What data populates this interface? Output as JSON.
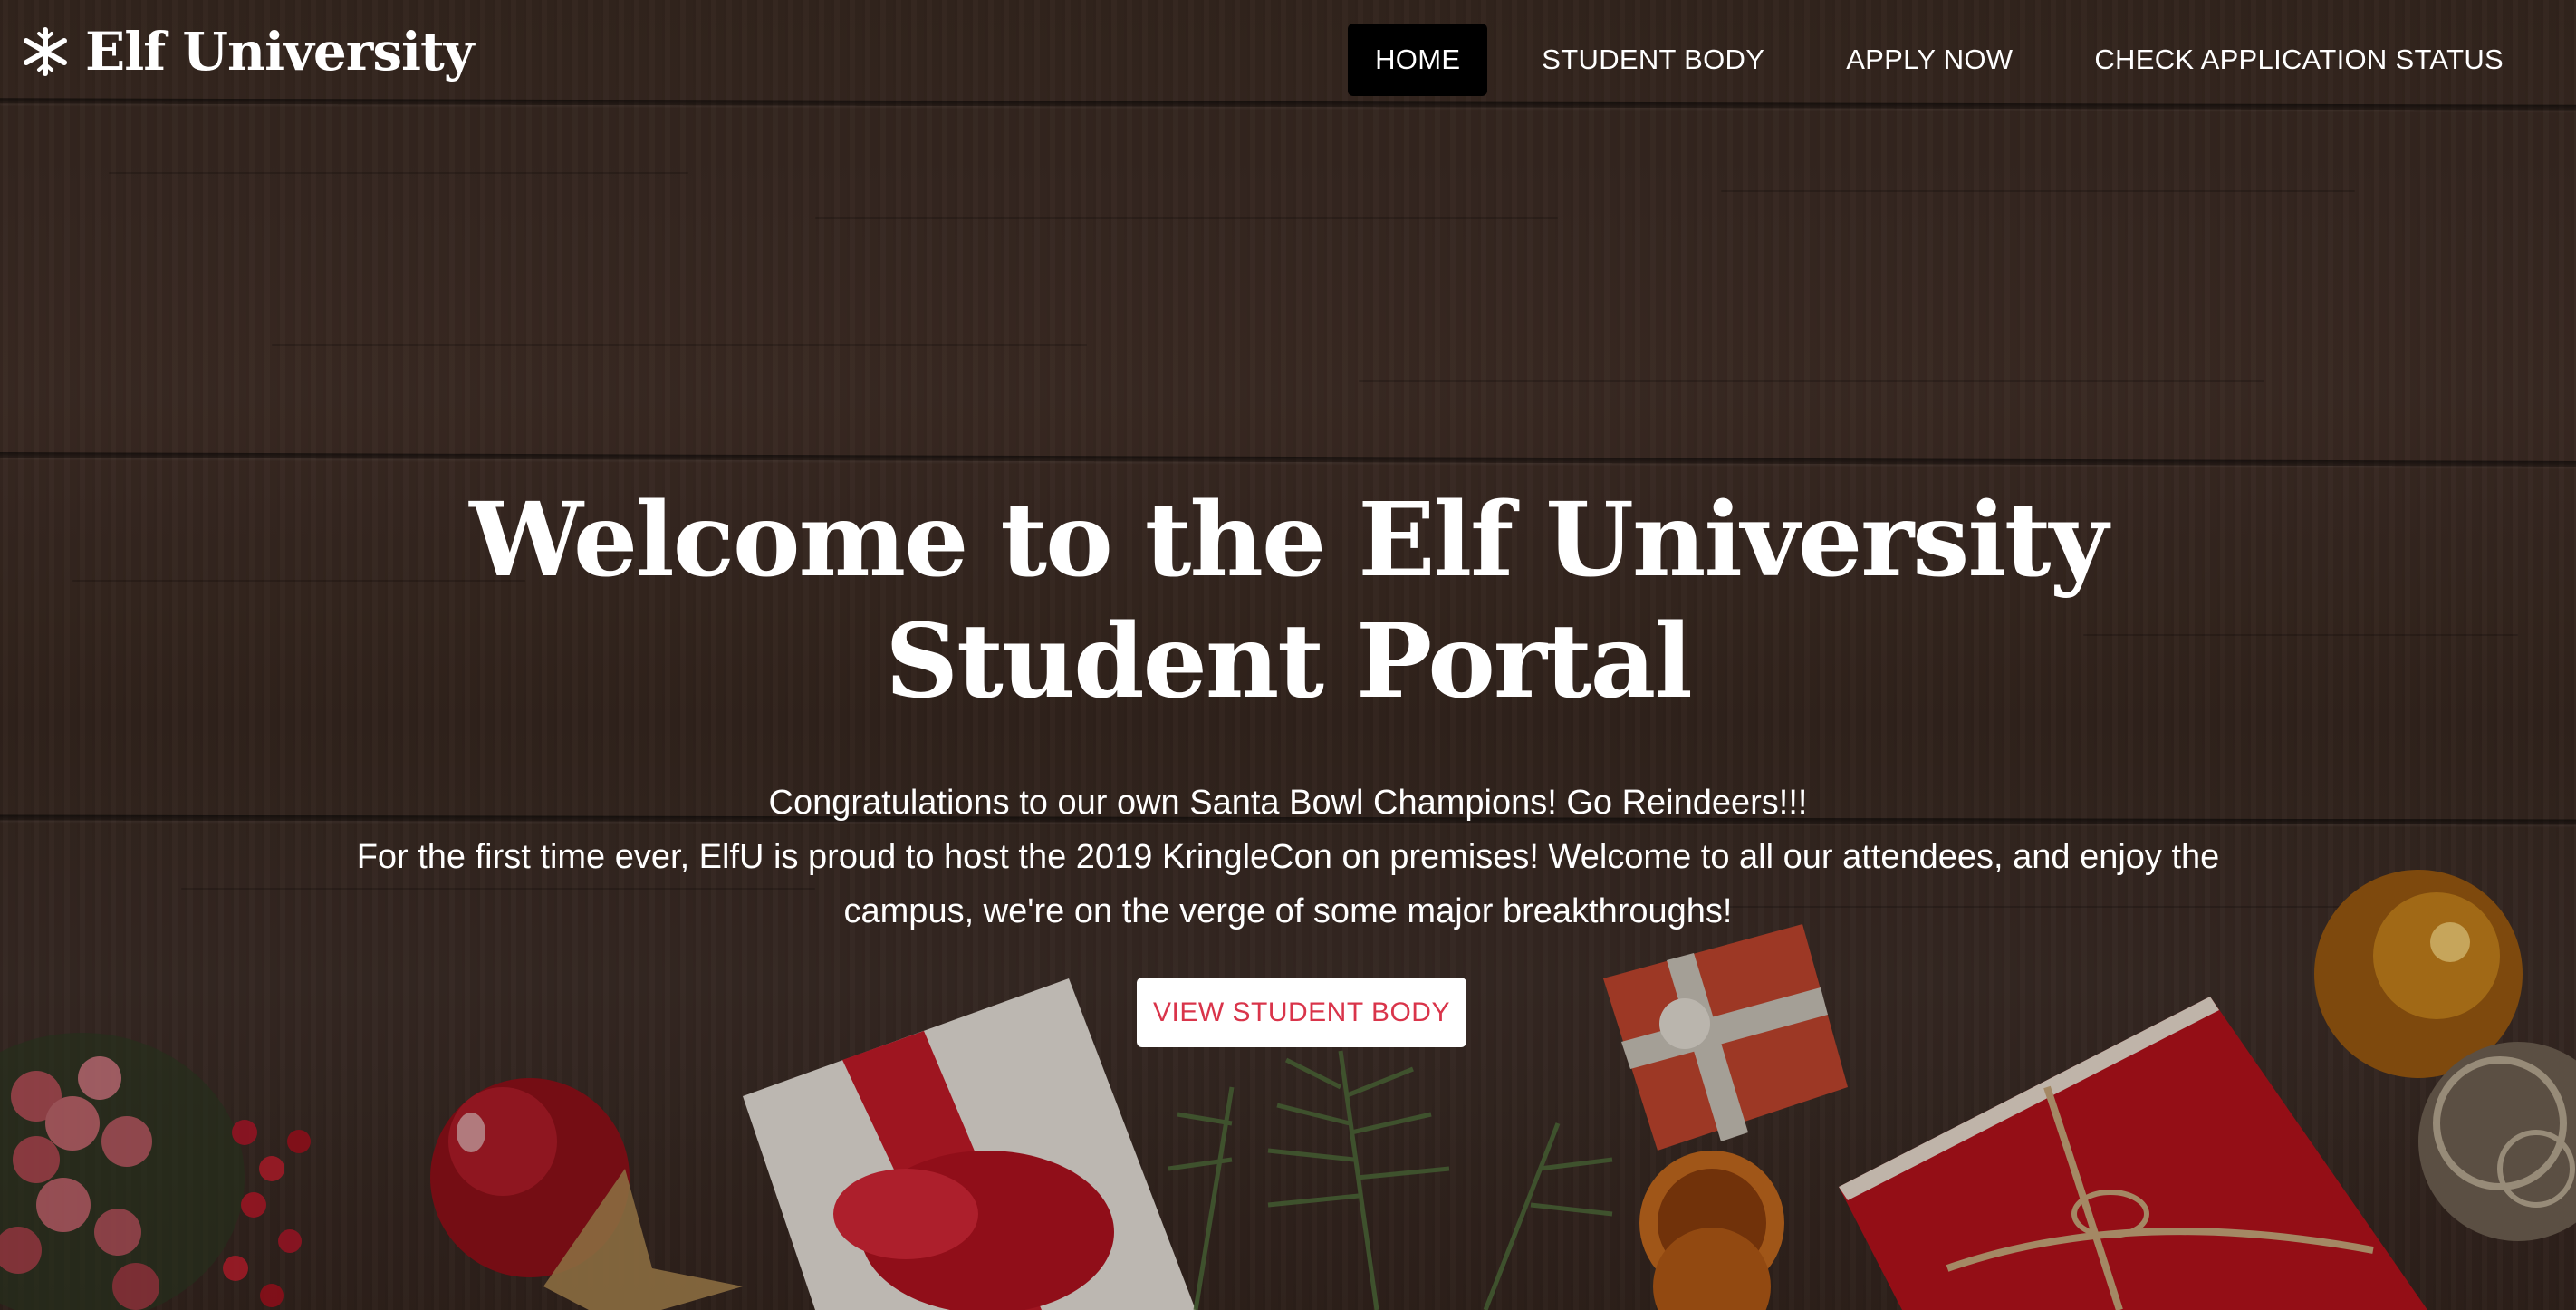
{
  "brand": {
    "name": "Elf University",
    "icon": "snowflake-icon"
  },
  "nav": {
    "items": [
      {
        "label": "HOME",
        "active": true
      },
      {
        "label": "STUDENT BODY",
        "active": false
      },
      {
        "label": "APPLY NOW",
        "active": false
      },
      {
        "label": "CHECK APPLICATION STATUS",
        "active": false
      }
    ]
  },
  "hero": {
    "title": "Welcome to the Elf University Student Portal",
    "line1": "Congratulations to our own Santa Bowl Champions! Go Reindeers!!!",
    "line2": "For the first time ever, ElfU is proud to host the 2019 KringleCon on premises! Welcome to all our attendees, and enjoy the campus, we're on the verge of some major breakthroughs!",
    "button_label": "VIEW STUDENT BODY"
  },
  "colors": {
    "active_nav_bg": "#000000",
    "button_text": "#d9344a",
    "button_bg": "#ffffff",
    "text": "#ffffff"
  }
}
